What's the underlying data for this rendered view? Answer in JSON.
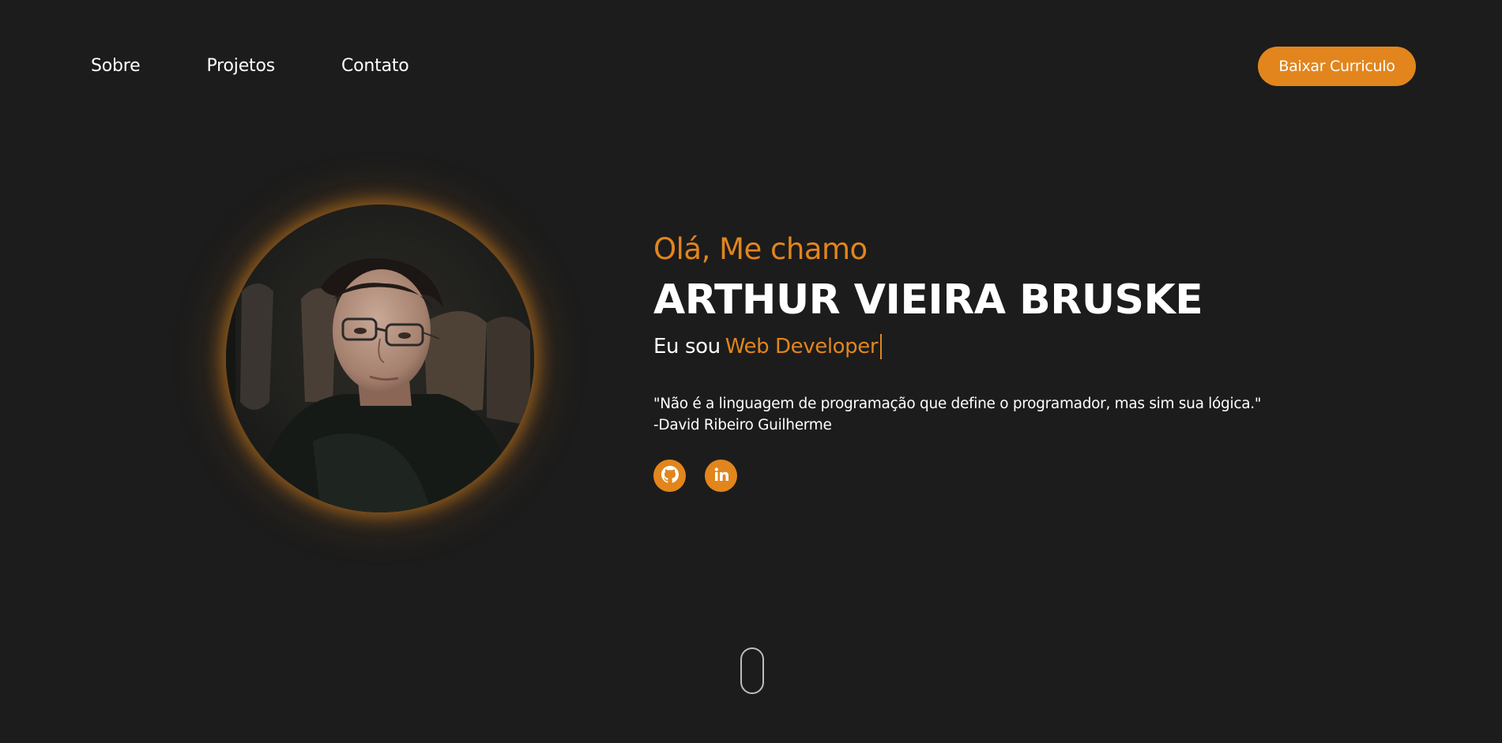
{
  "nav": {
    "items": [
      {
        "label": "Sobre"
      },
      {
        "label": "Projetos"
      },
      {
        "label": "Contato"
      }
    ],
    "cv_button_label": "Baixar Curriculo"
  },
  "hero": {
    "greeting": "Olá, Me chamo",
    "name": "ARTHUR VIEIRA BRUSKE",
    "role_prefix": "Eu sou",
    "role_value": "Web Developer",
    "quote_text": "\"Não é a linguagem de programação que define o programador, mas sim sua lógica.\"",
    "quote_author": "-David Ribeiro Guilherme"
  },
  "socials": [
    {
      "icon": "github-icon"
    },
    {
      "icon": "linkedin-icon"
    }
  ],
  "colors": {
    "background": "#1c1c1c",
    "accent": "#e2851d",
    "text": "#ffffff"
  }
}
